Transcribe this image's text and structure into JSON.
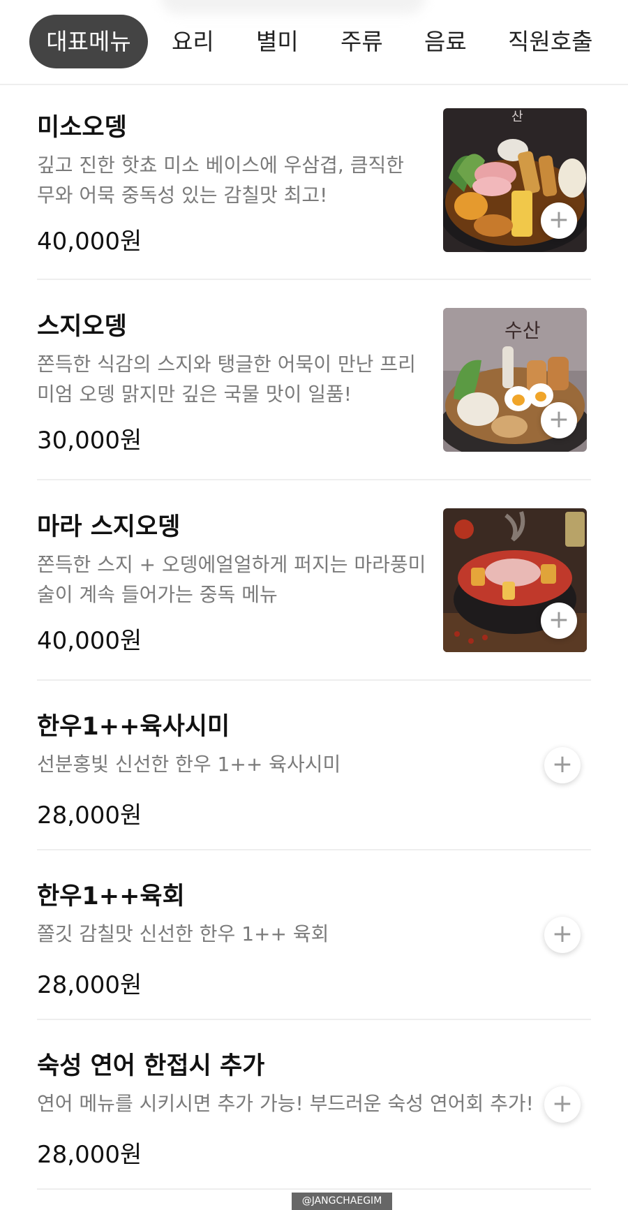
{
  "tabs": [
    {
      "label": "대표메뉴",
      "active": true
    },
    {
      "label": "요리",
      "active": false
    },
    {
      "label": "별미",
      "active": false
    },
    {
      "label": "주류",
      "active": false
    },
    {
      "label": "음료",
      "active": false
    },
    {
      "label": "직원호출",
      "active": false
    }
  ],
  "items": [
    {
      "title": "미소오뎅",
      "desc": "깊고 진한 핫쵸 미소 베이스에 우삼겹, 큼직한 무와 어묵 중독성 있는 감칠맛 최고!",
      "price": "40,000원",
      "image_text": "산",
      "has_image": true
    },
    {
      "title": "스지오뎅",
      "desc": "쫀득한 식감의 스지와 탱글한 어묵이 만난 프리미엄 오뎅 맑지만 깊은 국물 맛이 일품!",
      "price": "30,000원",
      "image_text": "수산",
      "has_image": true
    },
    {
      "title": "마라 스지오뎅",
      "desc": "쫀득한 스지 + 오뎅에얼얼하게 퍼지는 마라풍미 술이 계속 들어가는 중독 메뉴",
      "price": "40,000원",
      "has_image": true
    },
    {
      "title": "한우1++육사시미",
      "desc": "선분홍빛 신선한 한우 1++ 육사시미",
      "price": "28,000원",
      "has_image": false
    },
    {
      "title": "한우1++육회",
      "desc": "쫄깃 감칠맛 신선한 한우 1++ 육회",
      "price": "28,000원",
      "has_image": false
    },
    {
      "title": "숙성 연어 한접시 추가",
      "desc": "연어 메뉴를 시키시면 추가 가능! 부드러운 숙성 연어회 추가!",
      "price": "28,000원",
      "has_image": false
    }
  ],
  "add_symbol": "+",
  "watermark": "@JANGCHAEGIM",
  "colors": {
    "active_tab_bg": "#444444",
    "desc_text": "#7a7a7a",
    "divider": "#eeeeee"
  }
}
